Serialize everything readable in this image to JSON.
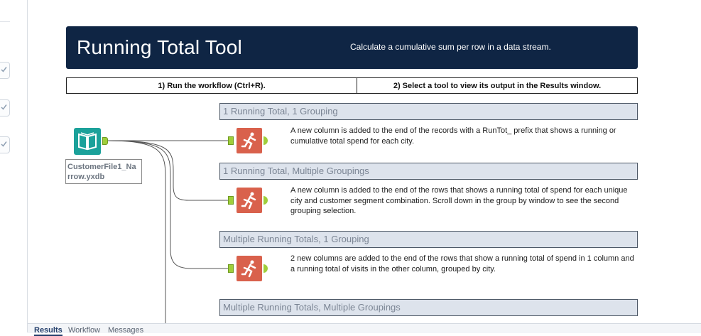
{
  "header": {
    "title": "Running Total Tool",
    "subtitle": "Calculate a cumulative sum per row in a data stream."
  },
  "steps": {
    "step1": "1) Run the workflow (Ctrl+R).",
    "step2": "2) Select a tool to view its output in the Results window."
  },
  "input_tool": {
    "label": "CustomerFile1_Na\nrrow.yxdb",
    "icon": "book-icon"
  },
  "groups": [
    {
      "title": "1 Running Total, 1 Grouping",
      "description": "A new column is added to the end of the records with a RunTot_ prefix that shows a running or cumulative total spend for each city."
    },
    {
      "title": "1 Running Total, Multiple Groupings",
      "description": "A new column is added to the end of the rows that shows a running total of spend for each unique city and customer segment combination. Scroll down in the group by window to see the second grouping selection."
    },
    {
      "title": "Multiple Running Totals, 1 Grouping",
      "description": "2 new columns are added to the end of the rows that show a running total of spend in 1 column and a running total of visits in the other column, grouped by city."
    },
    {
      "title": "Multiple Running Totals, Multiple Groupings"
    }
  ],
  "bottom_tabs": [
    "Results",
    "Workflow",
    "Messages"
  ],
  "colors": {
    "header_bg": "#0f2544",
    "tool_orange": "#d9614c",
    "input_teal": "#1ba19a",
    "anchor_green": "#9fce3b",
    "group_header_bg": "#dde3ec"
  }
}
